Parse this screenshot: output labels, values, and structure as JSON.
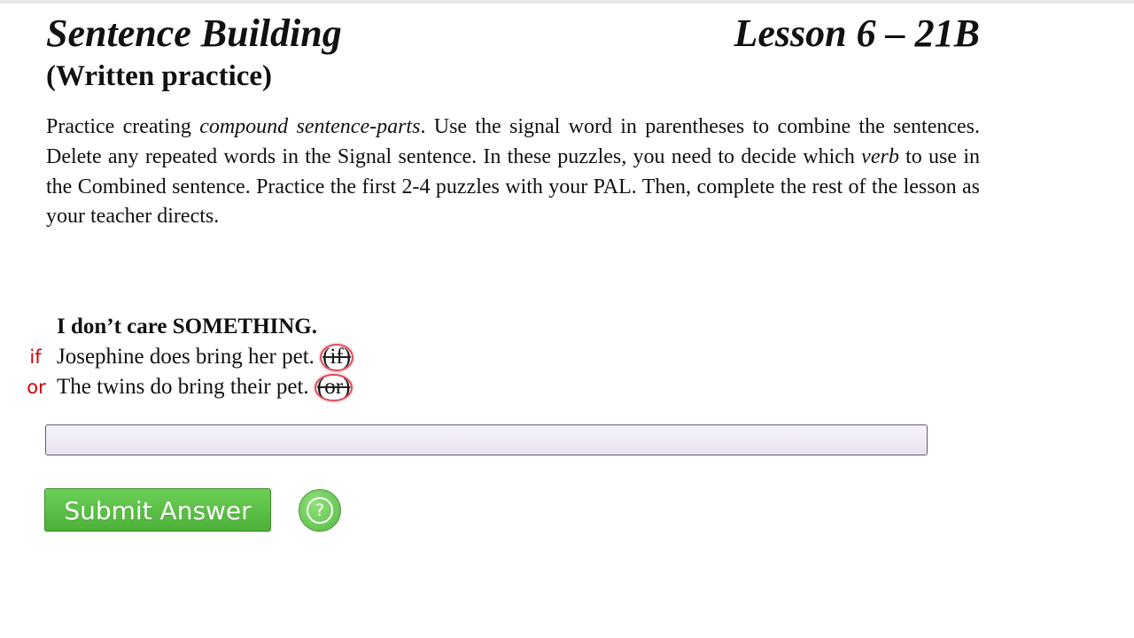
{
  "header": {
    "title": "Sentence Building",
    "lesson": "Lesson 6 – 21B",
    "subtitle": "(Written practice)"
  },
  "instructions": {
    "p1": "Practice creating ",
    "em1": "compound sentence-parts",
    "p2": ". Use the signal word in parentheses to combine the sentences. Delete any repeated words in the Signal sentence. In these puzzles, you need to decide which ",
    "em2": "verb",
    "p3": " to use in the Combined sentence.  Practice the first 2-4 puzzles with your PAL. Then, complete the rest of the lesson as your teacher directs."
  },
  "puzzle": {
    "main_sentence": "I don’t care SOMETHING.",
    "signal_sentences": [
      {
        "side_label": "if",
        "text": "Josephine does bring her pet. ",
        "signal": "(if)"
      },
      {
        "side_label": "or",
        "text": "The twins do bring their pet. ",
        "signal": "(or)"
      }
    ]
  },
  "answer": {
    "value": "",
    "placeholder": ""
  },
  "actions": {
    "submit_label": "Submit Answer",
    "help_icon": "question-circle-icon",
    "help_glyph": "?"
  },
  "colors": {
    "side_label": "#d40000",
    "signal_ring": "#e04c5c",
    "submit_button": "#5cc148",
    "input_border": "#6a5a7a"
  }
}
